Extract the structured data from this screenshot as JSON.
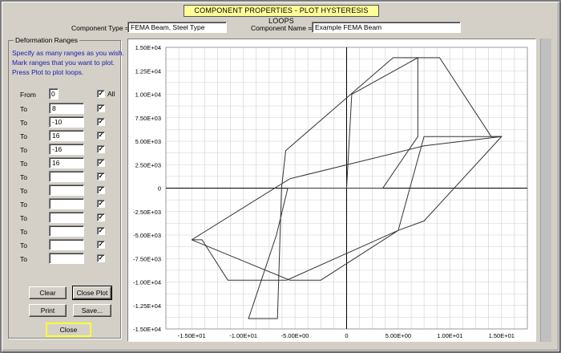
{
  "window": {
    "title": "COMPONENT PROPERTIES - PLOT HYSTERESIS LOOPS",
    "component_type_label": "Component Type =",
    "component_type_value": "FEMA Beam, Steel Type",
    "component_name_label": "Component Name =",
    "component_name_value": "Example FEMA Beam"
  },
  "deformation": {
    "group_title": "Deformation Ranges",
    "instructions": [
      "Specify as many ranges as you wish.",
      "Mark ranges that you want to plot.",
      "Press Plot to plot loops."
    ],
    "from_label": "From",
    "from_value": "0",
    "all_label": "All",
    "all_checked": true,
    "to_label": "To",
    "rows": [
      {
        "value": "8",
        "checked": true
      },
      {
        "value": "-10",
        "checked": true
      },
      {
        "value": "16",
        "checked": true
      },
      {
        "value": "-16",
        "checked": true
      },
      {
        "value": "16",
        "checked": true
      },
      {
        "value": "",
        "checked": true
      },
      {
        "value": "",
        "checked": true
      },
      {
        "value": "",
        "checked": true
      },
      {
        "value": "",
        "checked": true
      },
      {
        "value": "",
        "checked": true
      },
      {
        "value": "",
        "checked": true
      },
      {
        "value": "",
        "checked": true
      }
    ]
  },
  "buttons": {
    "clear": "Clear",
    "close_plot": "Close Plot",
    "print": "Print",
    "save": "Save...",
    "close": "Close"
  },
  "chart_data": {
    "type": "line",
    "xlim": [
      -17.5,
      17.5
    ],
    "ylim": [
      -15000,
      15000
    ],
    "grid": true,
    "x_ticks": [
      -15,
      -10,
      -5,
      0,
      5,
      10,
      15
    ],
    "x_tick_labels": [
      "-1.50E+01",
      "-1.00E+01",
      "-5.00E+00",
      "0",
      "5.00E+00",
      "1.00E+01",
      "1.50E+01"
    ],
    "y_ticks": [
      15000,
      12500,
      10000,
      7500,
      5000,
      2500,
      0,
      -2500,
      -5000,
      -7500,
      -10000,
      -12500,
      -15000
    ],
    "y_tick_labels": [
      "1.50E+04",
      "1.25E+04",
      "1.00E+04",
      "7.50E+03",
      "5.00E+03",
      "2.50E+03",
      "0",
      "-2.50E+03",
      "-5.00E+03",
      "-7.50E+03",
      "-1.00E+04",
      "-1.25E+04",
      "-1.50E+04"
    ],
    "series": [
      {
        "x": [
          0,
          0.5,
          4.6,
          6.9,
          6.9,
          3.5,
          -5.7,
          -6.8,
          -9.5,
          -6.7,
          -6.3,
          -5.9,
          4.5,
          9.0,
          14.0,
          15.0
        ],
        "y": [
          0,
          10000,
          12500,
          13900,
          5500,
          0,
          0,
          -5000,
          -13900,
          -13900,
          0,
          4000,
          13900,
          13900,
          5500,
          5500
        ]
      },
      {
        "x": [
          -15.0,
          -14.0,
          -11.5,
          -5.8,
          5.0,
          7.5,
          9.0,
          15.0,
          7.5,
          5.0,
          -2.5,
          -5.5,
          -15.0
        ],
        "y": [
          -5500,
          -5500,
          -9800,
          -9800,
          -4500,
          5500,
          5500,
          5500,
          -3500,
          -4500,
          -9800,
          -9800,
          -5500
        ]
      },
      {
        "x": [
          -15.0,
          -5.5,
          7.5,
          15.0
        ],
        "y": [
          -5500,
          1000,
          4500,
          5500
        ]
      }
    ]
  }
}
